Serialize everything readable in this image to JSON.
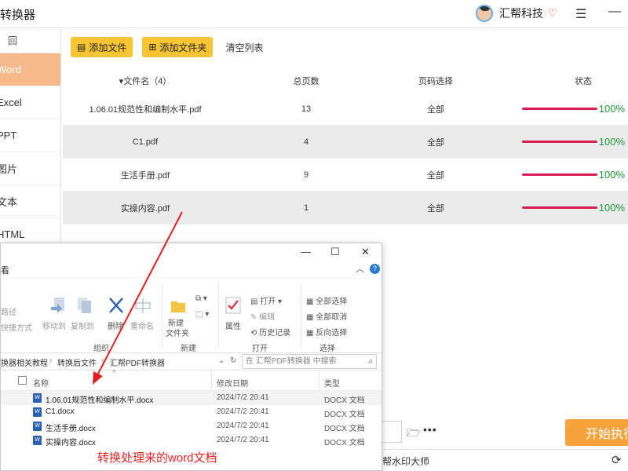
{
  "app": {
    "title": "转换器",
    "username": "汇帮科技",
    "menu_glyph": "☰",
    "minimize_glyph": "—"
  },
  "sidebar": {
    "top_label": "回",
    "items": [
      {
        "label": "Word",
        "active": true
      },
      {
        "label": "Excel"
      },
      {
        "label": "PPT"
      },
      {
        "label": "图片"
      },
      {
        "label": "文本"
      },
      {
        "label": "HTML"
      }
    ]
  },
  "toolbar": {
    "add_file": "添加文件",
    "add_folder": "添加文件夹",
    "clear_list": "清空列表"
  },
  "table": {
    "headers": {
      "name": "▾文件名（4）",
      "pages": "总页数",
      "range": "页码选择",
      "status": "状态"
    },
    "rows": [
      {
        "name": "1.06.01规范性和编制水平.pdf",
        "pages": "13",
        "range": "全部",
        "percent": "100%"
      },
      {
        "name": "C1.pdf",
        "pages": "4",
        "range": "全部",
        "percent": "100%"
      },
      {
        "name": "生活手册.pdf",
        "pages": "9",
        "range": "全部",
        "percent": "100%"
      },
      {
        "name": "实操内容.pdf",
        "pages": "1",
        "range": "全部",
        "percent": "100%"
      }
    ]
  },
  "explorer": {
    "controls": {
      "minimize": "—",
      "maximize": "☐",
      "close": "✕"
    },
    "tab_view": "看",
    "help": "?",
    "ribbon": {
      "path_label": "路径",
      "shortcut_label": "快捷方式",
      "move_to": "移动到",
      "copy_to": "复制到",
      "delete": "删除",
      "rename": "重命名",
      "new_folder_line1": "新建",
      "new_folder_line2": "文件夹",
      "properties": "属性",
      "open": "打开",
      "edit": "编辑",
      "history": "历史记录",
      "select_all": "全部选择",
      "select_none": "全部取消",
      "invert": "反向选择",
      "groups": {
        "organize": "组织",
        "new": "新建",
        "open": "打开",
        "select": "选择"
      }
    },
    "address": {
      "crumb1": "换器相关教程",
      "crumb2": "转换后文件",
      "crumb3": "汇帮PDF转换器",
      "search_placeholder": "在 汇帮PDF转换器 中搜索"
    },
    "columns": {
      "name": "名称",
      "date": "修改日期",
      "type": "类型"
    },
    "files": [
      {
        "name": "1.06.01规范性和编制水平.docx",
        "date": "2024/7/2 20:41",
        "type": "DOCX 文档"
      },
      {
        "name": "C1.docx",
        "date": "2024/7/2 20:41",
        "type": "DOCX 文档"
      },
      {
        "name": "生活手册.docx",
        "date": "2024/7/2 20:41",
        "type": "DOCX 文档"
      },
      {
        "name": "实操内容.docx",
        "date": "2024/7/2 20:41",
        "type": "DOCX 文档"
      }
    ]
  },
  "annotation": "转换处理来的word文档",
  "bottom": {
    "start_button": "开始执行",
    "watermark_link": "帮水印大师"
  },
  "colors": {
    "accent": "#f7c433",
    "progress": "#d81e55",
    "percent_text": "#1a9a3a",
    "start": "#f7a23a",
    "active_tab": "#f5b98c"
  }
}
